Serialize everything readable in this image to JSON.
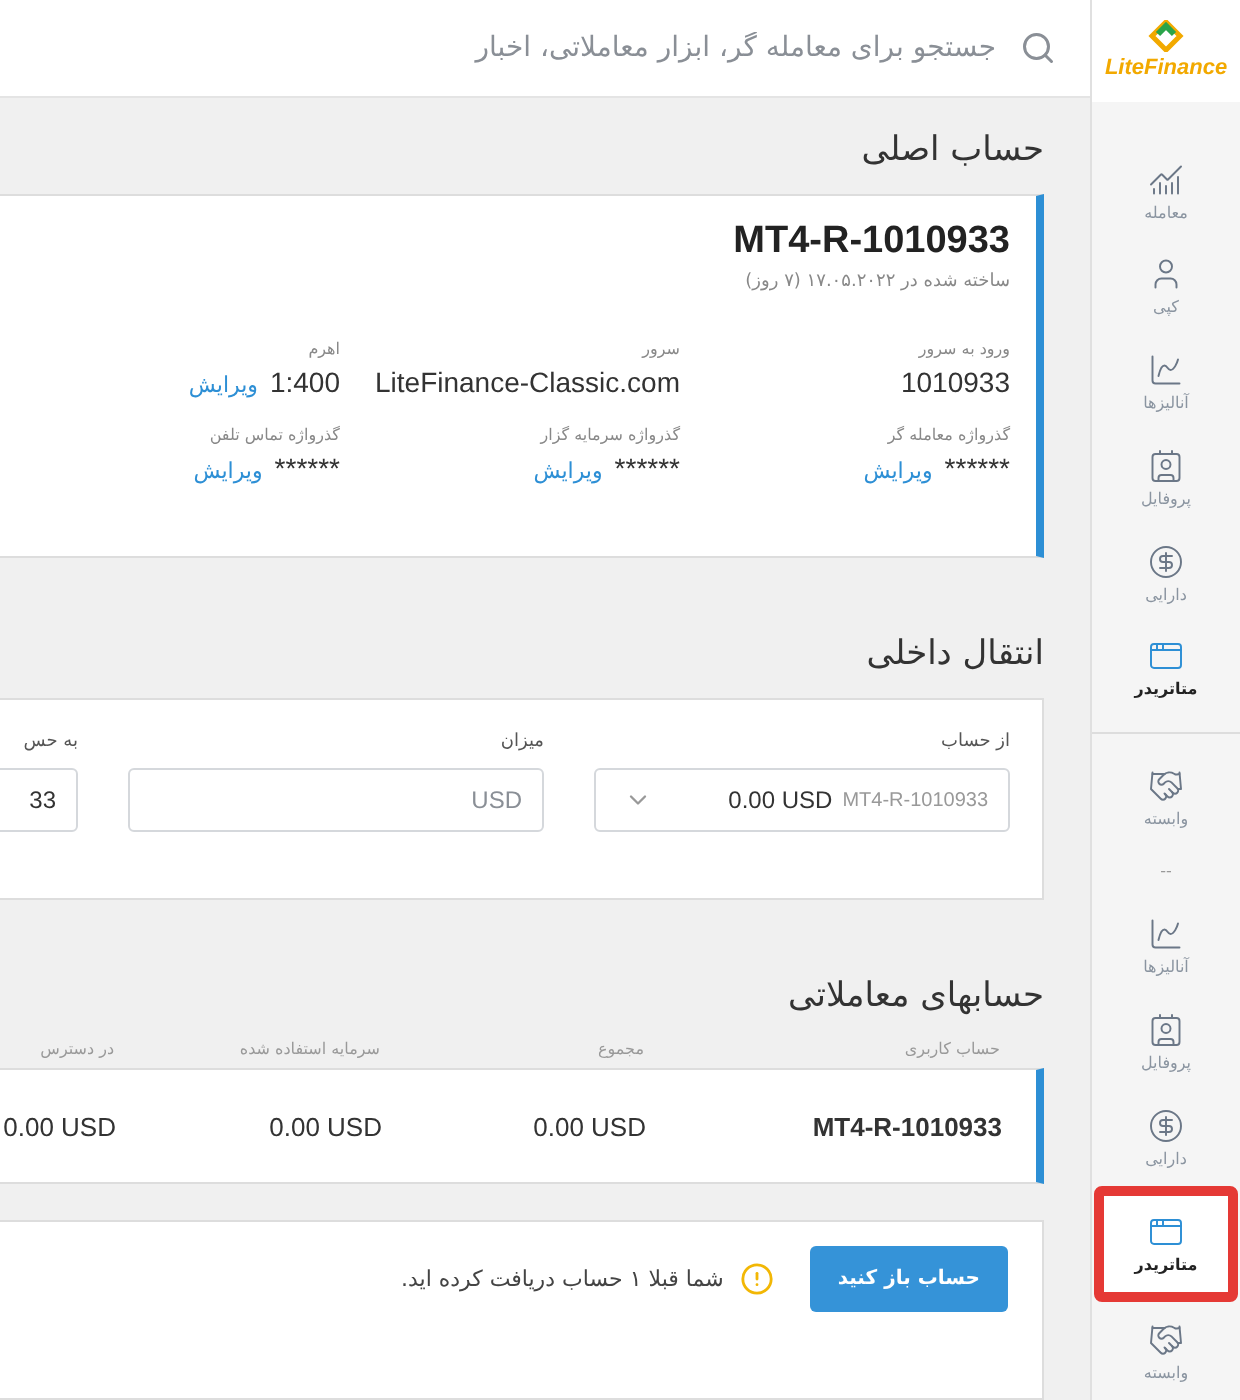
{
  "logo": {
    "text": "LiteFinance"
  },
  "search": {
    "placeholder": "جستجو برای معامله گر، ابزار معاملاتی، اخبار"
  },
  "sidebar": {
    "items": [
      {
        "kind": "trade",
        "label": "معامله",
        "selected": false,
        "highlighted": false
      },
      {
        "kind": "copy",
        "label": "کپی",
        "selected": false,
        "highlighted": false
      },
      {
        "kind": "analysis",
        "label": "آنالیزها",
        "selected": false,
        "highlighted": false
      },
      {
        "kind": "profile",
        "label": "پروفایل",
        "selected": false,
        "highlighted": false
      },
      {
        "kind": "assets",
        "label": "دارایی",
        "selected": false,
        "highlighted": false
      },
      {
        "kind": "platform",
        "label": "متاتریدر",
        "selected": true,
        "highlighted": false
      },
      {
        "kind": "divider"
      },
      {
        "kind": "partner",
        "label": "وابسته",
        "selected": false,
        "highlighted": false
      },
      {
        "kind": "dots",
        "label": "--"
      },
      {
        "kind": "analysis",
        "label": "آنالیزها",
        "selected": false,
        "highlighted": false
      },
      {
        "kind": "profile",
        "label": "پروفایل",
        "selected": false,
        "highlighted": false
      },
      {
        "kind": "assets",
        "label": "دارایی",
        "selected": false,
        "highlighted": false
      },
      {
        "kind": "platform",
        "label": "متاتریدر",
        "selected": true,
        "highlighted": true
      },
      {
        "kind": "partner",
        "label": "وابسته",
        "selected": false,
        "highlighted": false
      }
    ]
  },
  "main_account": {
    "heading": "حساب اصلی",
    "account": "MT4-R-1010933",
    "created": "ساخته شده در ۱۷.۰۵.۲۰۲۲ (۷ روز)",
    "fields": [
      {
        "label": "ورود به سرور",
        "value": "1010933"
      },
      {
        "label": "سرور",
        "value": "LiteFinance-Classic.com"
      },
      {
        "label": "اهرم",
        "value": "1:400",
        "link": "ویرایش"
      },
      {
        "label": "گذرواژه معامله گر",
        "value": "******",
        "link": "ویرایش"
      },
      {
        "label": "گذرواژه سرمایه گزار",
        "value": "******",
        "link": "ویرایش"
      },
      {
        "label": "گذرواژه تماس تلفن",
        "value": "******",
        "link": "ویرایش"
      }
    ]
  },
  "transfer": {
    "heading": "انتقال داخلی",
    "fields": [
      {
        "kind": "select",
        "label": "از حساب",
        "account": "MT4-R-1010933",
        "value": "0.00 USD"
      },
      {
        "kind": "input",
        "label": "میزان",
        "placeholder": "USD"
      },
      {
        "kind": "select",
        "label": "به حس",
        "value": "33"
      }
    ]
  },
  "trading_accounts": {
    "heading": "حسابهای معاملاتی",
    "columns": [
      "حساب کاربری",
      "مجموع",
      "سرمایه استفاده شده",
      "در دسترس"
    ],
    "rows": [
      [
        "MT4-R-1010933",
        "0.00 USD",
        "0.00 USD",
        "0.00 USD"
      ]
    ]
  },
  "open_account": {
    "button": "حساب باز کنید",
    "notice": "شما قبلا ۱ حساب دریافت کرده اید."
  }
}
